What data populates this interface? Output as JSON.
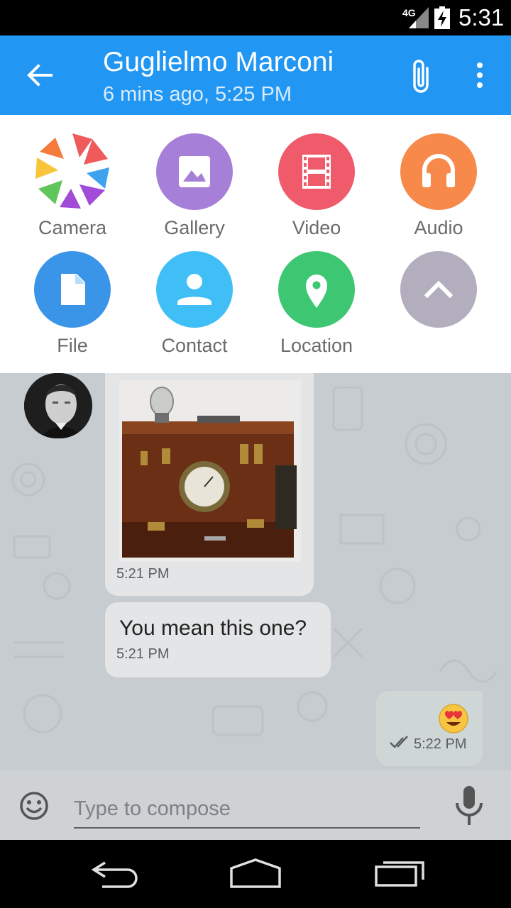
{
  "status": {
    "network": "4G",
    "time": "5:31"
  },
  "header": {
    "title": "Guglielmo Marconi",
    "subtitle": "6 mins ago, 5:25 PM",
    "color": "#2196F3"
  },
  "attach_menu": {
    "items": [
      {
        "label": "Camera",
        "icon": "camera-icon"
      },
      {
        "label": "Gallery",
        "icon": "image-icon",
        "color": "#A67FD8"
      },
      {
        "label": "Video",
        "icon": "film-icon",
        "color": "#EF5B6A"
      },
      {
        "label": "Audio",
        "icon": "headphones-icon",
        "color": "#F7894A"
      },
      {
        "label": "File",
        "icon": "file-icon",
        "color": "#3A95E8"
      },
      {
        "label": "Contact",
        "icon": "person-icon",
        "color": "#40BEF6"
      },
      {
        "label": "Location",
        "icon": "location-pin-icon",
        "color": "#3EC773"
      },
      {
        "label": "",
        "icon": "chevron-up-icon",
        "color": "#B2AEBD"
      }
    ]
  },
  "messages": [
    {
      "type": "photo",
      "time": "5:21 PM",
      "direction": "incoming"
    },
    {
      "type": "text",
      "text": "You mean this one?",
      "time": "5:21 PM",
      "direction": "incoming"
    },
    {
      "type": "emoji",
      "emoji": "😍",
      "time": "5:22 PM",
      "direction": "outgoing",
      "status": "read"
    }
  ],
  "compose": {
    "placeholder": "Type to compose"
  }
}
